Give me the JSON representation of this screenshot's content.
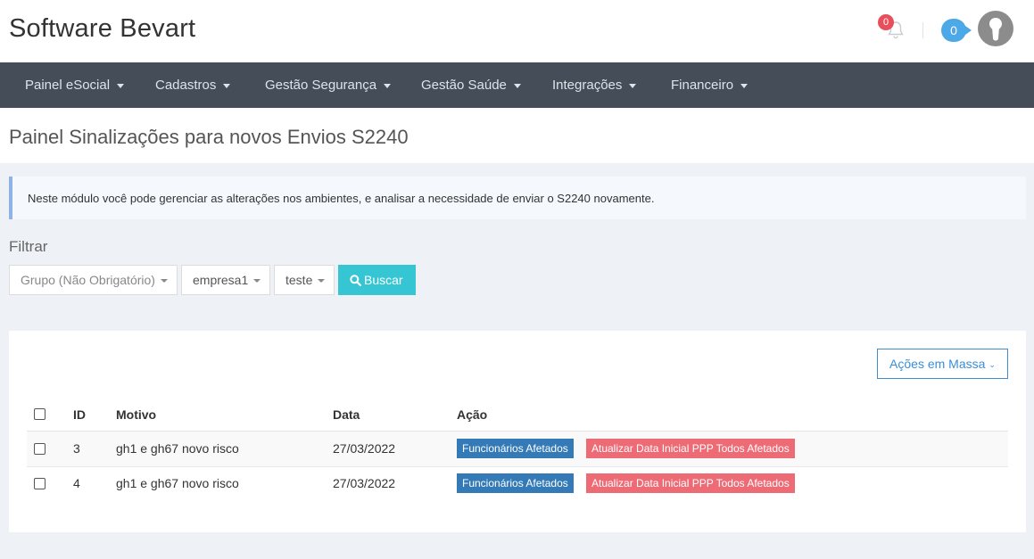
{
  "app": {
    "title": "Software Bevart"
  },
  "header": {
    "notifications_count": "0",
    "inbox_count": "0"
  },
  "nav": {
    "items": [
      {
        "label": "Painel eSocial"
      },
      {
        "label": "Cadastros"
      },
      {
        "label": "Gestão Segurança"
      },
      {
        "label": "Gestão Saúde"
      },
      {
        "label": "Integrações"
      },
      {
        "label": "Financeiro"
      }
    ]
  },
  "page": {
    "title": "Painel Sinalizações para novos Envios S2240"
  },
  "alert": {
    "text": "Neste módulo você pode gerenciar as alterações nos ambientes, e analisar a necessidade de enviar o S2240 novamente."
  },
  "filter": {
    "label": "Filtrar",
    "group_select": "Grupo (Não Obrigatório)",
    "company_select": "empresa1",
    "env_select": "teste",
    "search_button": "Buscar"
  },
  "panel": {
    "bulk_actions_label": "Ações em Massa",
    "columns": {
      "id": "ID",
      "motivo": "Motivo",
      "data": "Data",
      "acao": "Ação"
    },
    "rows": [
      {
        "id": "3",
        "motivo": "gh1 e gh67 novo risco",
        "data": "27/03/2022",
        "action_primary": "Funcionários Afetados",
        "action_secondary": "Atualizar Data Inicial PPP Todos Afetados"
      },
      {
        "id": "4",
        "motivo": "gh1 e gh67 novo risco",
        "data": "27/03/2022",
        "action_primary": "Funcionários Afetados",
        "action_secondary": "Atualizar Data Inicial PPP Todos Afetados"
      }
    ]
  },
  "colors": {
    "navbar": "#444d58",
    "accent_cyan": "#36c6d3",
    "badge_red": "#e7505a",
    "badge_blue": "#4da8e8",
    "tag_blue": "#337ab7",
    "tag_red": "#ed6b75"
  }
}
